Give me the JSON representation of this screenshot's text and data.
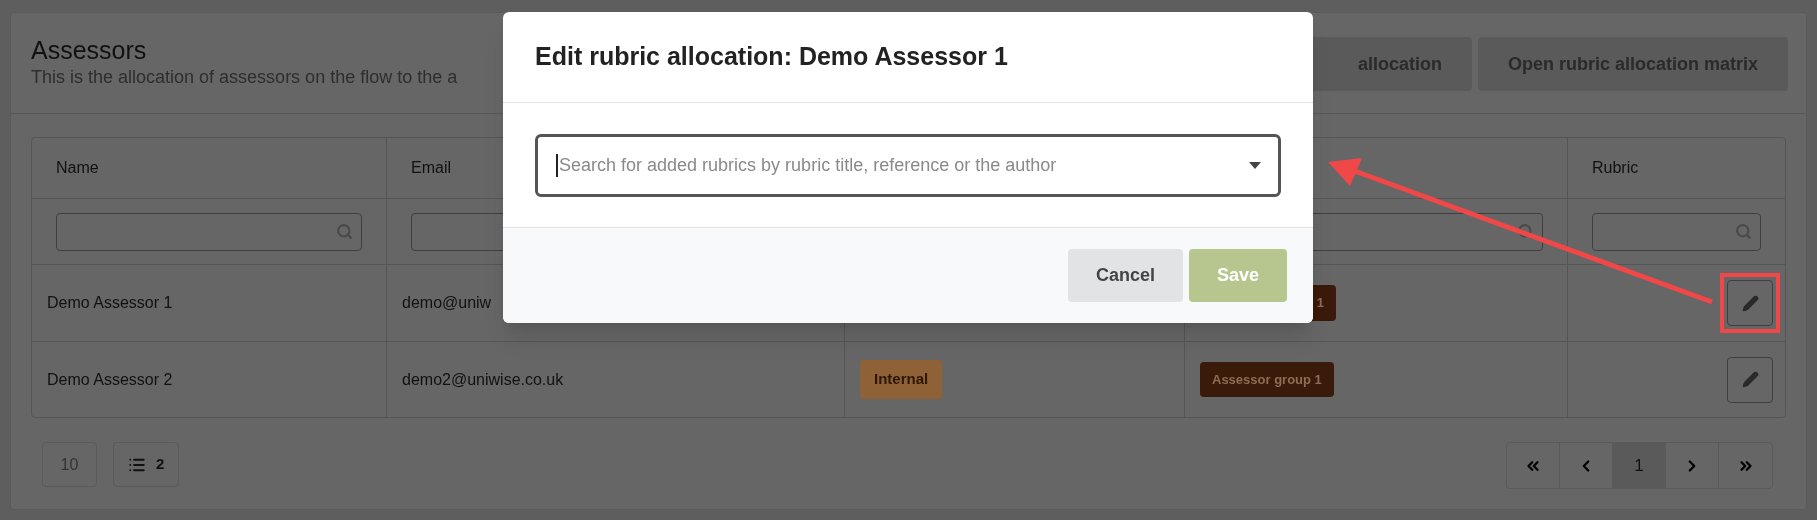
{
  "page": {
    "title": "Assessors",
    "description": "This is the allocation of assessors on the flow to the a",
    "buttons": [
      {
        "label": "allocation"
      },
      {
        "label": "Open rubric allocation matrix"
      }
    ]
  },
  "table": {
    "columns": [
      {
        "label": "Name",
        "filter": {
          "kind": "search"
        }
      },
      {
        "label": "Email",
        "filter": {
          "kind": "plain"
        }
      },
      {
        "filter": {
          "kind": "none"
        }
      },
      {
        "filter": {
          "kind": "search"
        }
      },
      {
        "label": "Rubric",
        "filter": {
          "kind": "search"
        }
      }
    ],
    "rows": [
      {
        "name": "Demo Assessor 1",
        "email": "demo@uniw",
        "group": "1",
        "highlighted": true
      },
      {
        "name": "Demo Assessor 2",
        "email": "demo2@uniwise.co.uk",
        "type": "Internal",
        "group": "Assessor group 1",
        "highlighted": false
      }
    ]
  },
  "pagination": {
    "page_size": "10",
    "count": "2",
    "pages": [
      {
        "label": "1",
        "selected": true
      }
    ]
  },
  "modal": {
    "title": "Edit rubric allocation: Demo Assessor 1",
    "select": {
      "placeholder": "Search for added rubrics by rubric title, reference or the author"
    },
    "buttons": [
      {
        "label": "Cancel",
        "kind": "secondary"
      },
      {
        "label": "Save",
        "kind": "primary"
      }
    ]
  }
}
